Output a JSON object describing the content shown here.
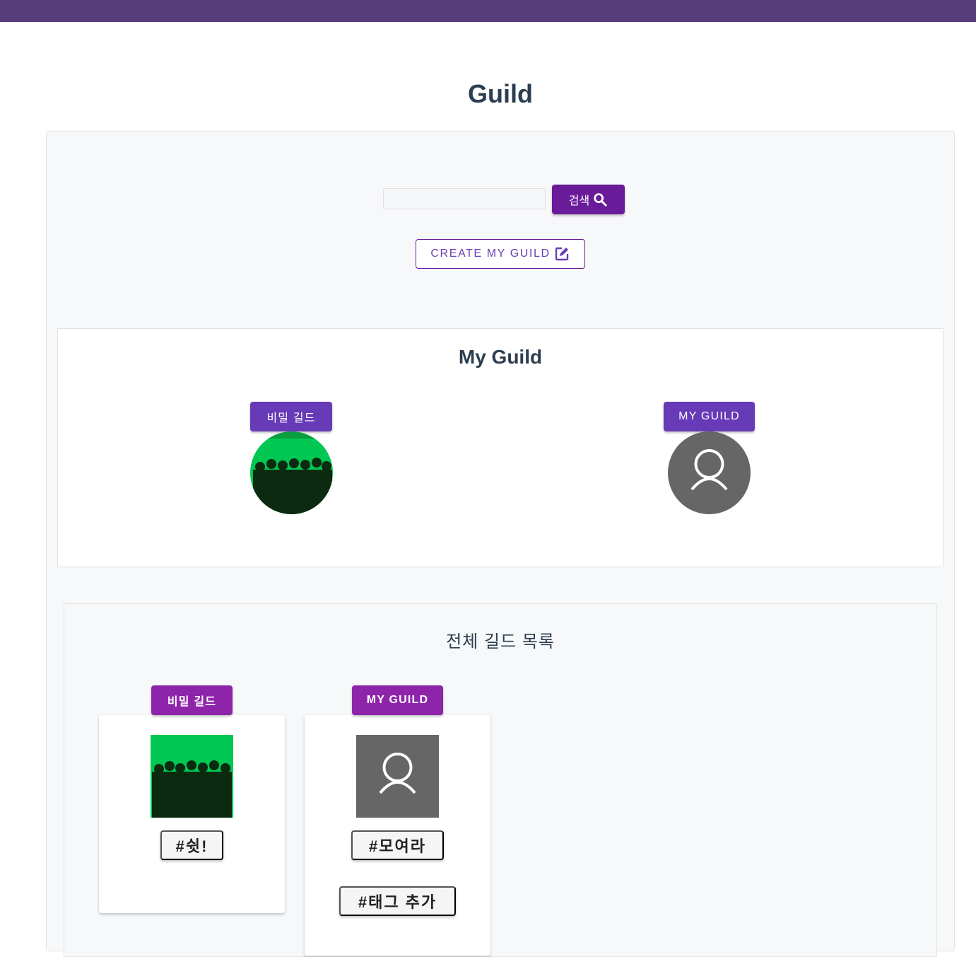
{
  "header": {
    "title": "Guild"
  },
  "search": {
    "placeholder": "",
    "value": "",
    "button_label": "검색"
  },
  "create": {
    "label": "CREATE MY GUILD"
  },
  "my_guild": {
    "title": "My Guild",
    "items": [
      {
        "chip": "비밀 길드",
        "image": "green-group-photo"
      },
      {
        "chip": "MY GUILD",
        "image": "default-user-icon"
      }
    ]
  },
  "all_guilds": {
    "title": "전체 길드 목록",
    "items": [
      {
        "chip": "비밀 길드",
        "image": "green-group-photo",
        "tags": [
          "#쉿!"
        ]
      },
      {
        "chip": "MY GUILD",
        "image": "default-user-icon",
        "tags": [
          "#모여라",
          "#태그 추가"
        ]
      }
    ]
  },
  "colors": {
    "topbar": "#563d7c",
    "primary": "#6a1b9a",
    "chip_purple": "#673ab7",
    "chip_violet": "#8e24aa"
  }
}
